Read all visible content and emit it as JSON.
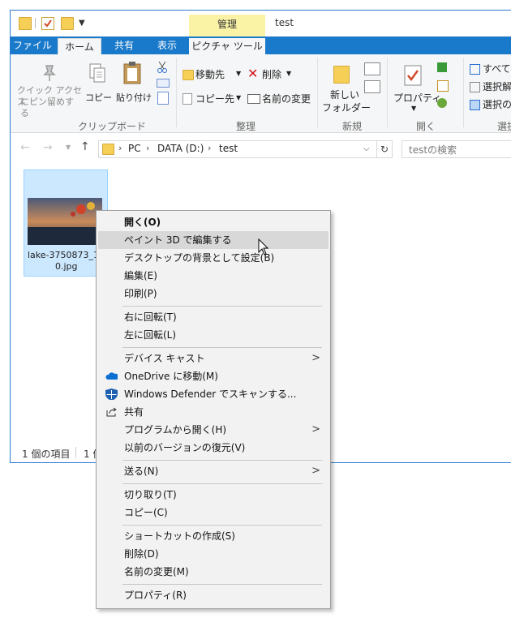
{
  "window": {
    "title": "test",
    "context_tab_group": "管理"
  },
  "tabs": [
    "ファイル",
    "ホーム",
    "共有",
    "表示",
    "ピクチャ ツール"
  ],
  "ribbon": {
    "clipboard": {
      "quick_access_line1": "クイック アクセス",
      "quick_access_line2": "にピン留めする",
      "copy": "コピー",
      "paste": "貼り付け",
      "group_label": "クリップボード"
    },
    "organize": {
      "move_to": "移動先",
      "copy_to": "コピー先",
      "delete": "削除",
      "rename": "名前の変更",
      "group_label": "整理"
    },
    "new": {
      "new_folder_line1": "新しい",
      "new_folder_line2": "フォルダー",
      "group_label": "新規"
    },
    "open": {
      "properties": "プロパティ",
      "group_label": "開く"
    },
    "select": {
      "select_all": "すべて選",
      "select_none": "選択解",
      "invert_selection": "選択の",
      "group_label": "選択"
    }
  },
  "address": {
    "crumbs": [
      "PC",
      "DATA (D:)",
      "test"
    ],
    "search_placeholder": "testの検索"
  },
  "file": {
    "name_line1": "lake-3750873_19",
    "name_line2": "0.jpg"
  },
  "status": {
    "item_count": "1 個の項目",
    "selected": "1 個"
  },
  "context_menu": {
    "items": [
      "開く(O)",
      "ペイント 3D で編集する",
      "デスクトップの背景として設定(B)",
      "編集(E)",
      "印刷(P)",
      "右に回転(T)",
      "左に回転(L)",
      "デバイス キャスト",
      "OneDrive に移動(M)",
      "Windows Defender でスキャンする...",
      "共有",
      "プログラムから開く(H)",
      "以前のバージョンの復元(V)",
      "送る(N)",
      "切り取り(T)",
      "コピー(C)",
      "ショートカットの作成(S)",
      "削除(D)",
      "名前の変更(M)",
      "プロパティ(R)"
    ]
  },
  "colors": {
    "accent": "#1979ca",
    "context_tab": "#faf3a6",
    "selection": "#cce8ff",
    "menu_bg": "#f2f2f2",
    "menu_highlight": "#d8d8d8",
    "onedrive": "#0a6fd1",
    "defender": "#1f5fb0"
  }
}
